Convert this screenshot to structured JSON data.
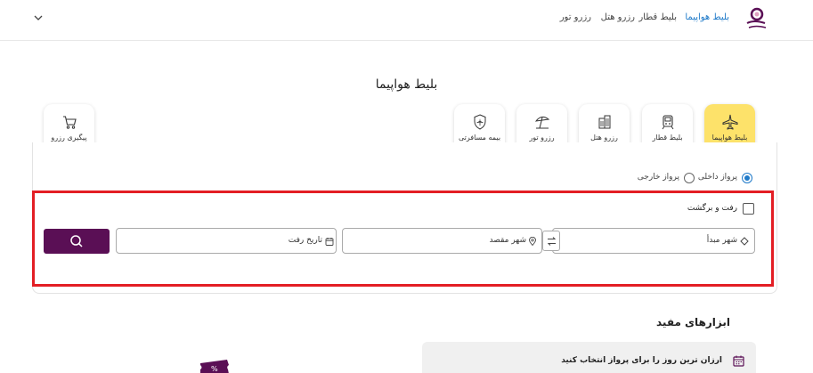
{
  "header": {
    "nav": {
      "flight": "بلیط هواپیما",
      "train": "بلیط قطار",
      "hotel": "رزرو هتل",
      "tour": "رزرو تور"
    }
  },
  "page_title": "بلیط هواپیما",
  "tabs": {
    "flight": "بلیط هواپیما",
    "train": "بلیط قطار",
    "hotel": "رزرو هتل",
    "tour": "رزرو تور",
    "insurance": "بیمه مسافرتی",
    "tracking": "پیگیری رزرو"
  },
  "trip_type": {
    "domestic": "پرواز داخلی",
    "international": "پرواز خارجی",
    "selected": "domestic"
  },
  "round_trip_label": "رفت و برگشت",
  "fields": {
    "origin": "شهر مبدأ",
    "destination": "شهر مقصد",
    "departure_date": "تاریخ رفت"
  },
  "tools": {
    "title": "ابزارهای مفید",
    "cheapest_day": "ارزان ترین روز را برای پرواز انتخاب کنید"
  },
  "colors": {
    "accent_blue": "#1f7ac9",
    "active_tab": "#fde26a",
    "search_button": "#5a0f55",
    "highlight": "#e31e24"
  }
}
